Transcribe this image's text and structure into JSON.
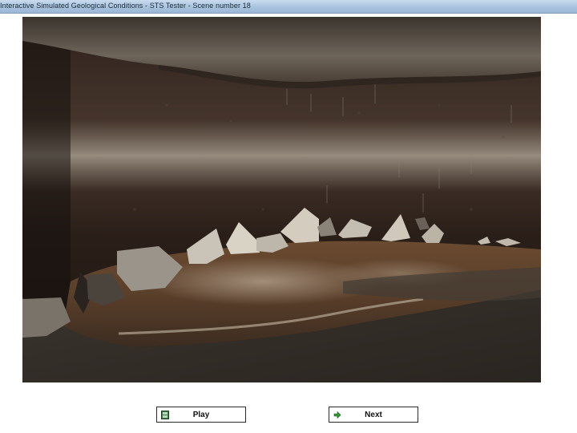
{
  "window": {
    "title": "Interactive Simulated Geological Conditions - STS Tester - Scene number 18"
  },
  "scene": {
    "description_icon": "cave-scene-image"
  },
  "controls": {
    "play_label": "Play",
    "next_label": "Next",
    "play_icon": "film-icon",
    "next_icon": "arrow-right-icon"
  },
  "colors": {
    "play_icon": "#3f7a4a",
    "next_icon": "#2f9a2f"
  }
}
